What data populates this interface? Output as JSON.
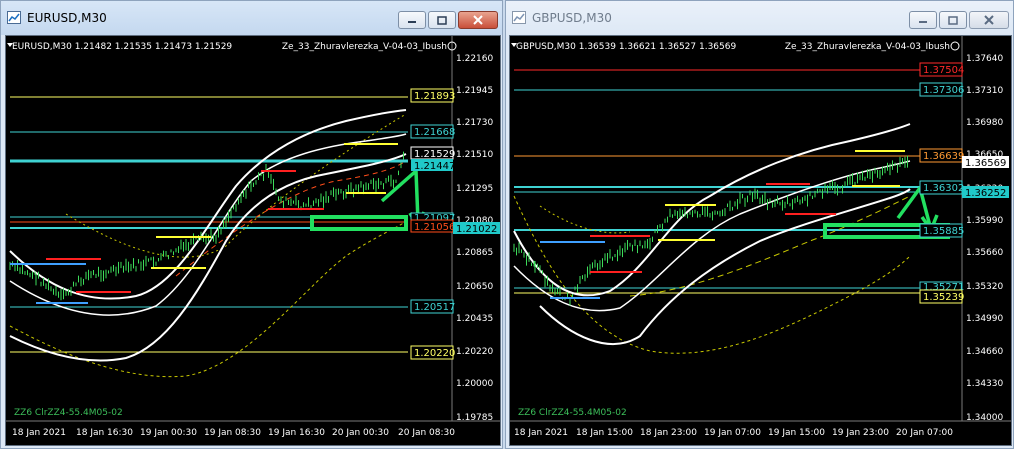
{
  "windows": [
    {
      "id": "eurusd",
      "title": "EURUSD,M30",
      "active": true,
      "symbol_info": "EURUSD,M30  1.21482 1.21535 1.21473 1.21529",
      "indicator": "Ze_33_Zhuravlerezka_V-04-03_Ibush",
      "footer": "ZZ6 ClrZZ4-55.4M05-02",
      "price_axis": [
        "1.22160",
        "1.21945",
        "1.21730",
        "1.21510",
        "1.21295",
        "1.21080",
        "1.20865",
        "1.20650",
        "1.20435",
        "1.20220",
        "1.20000",
        "1.19785"
      ],
      "time_axis": [
        "18 Jan 2021",
        "18 Jan 16:30",
        "19 Jan 00:30",
        "19 Jan 08:30",
        "19 Jan 16:30",
        "20 Jan 00:30",
        "20 Jan 08:30"
      ],
      "level_labels": [
        {
          "text": "1.21893",
          "color": "#ffff66"
        },
        {
          "text": "1.21668",
          "color": "#3fd3d3"
        },
        {
          "text": "1.21529",
          "color": "#ffffff"
        },
        {
          "text": "1.21447",
          "color": "#000000",
          "bg": "#20c9c9"
        },
        {
          "text": "1.21097",
          "color": "#3fd3d3"
        },
        {
          "text": "1.21056",
          "color": "#ff4d1a"
        },
        {
          "text": "1.21022",
          "color": "#000000",
          "bg": "#20c9c9"
        },
        {
          "text": "1.20517",
          "color": "#3fd3d3"
        },
        {
          "text": "1.20220",
          "color": "#ffff66"
        }
      ]
    },
    {
      "id": "gbpusd",
      "title": "GBPUSD,M30",
      "active": false,
      "symbol_info": "GBPUSD,M30  1.36539 1.36621 1.36527 1.36569",
      "indicator": "Ze_33_Zhuravlerezka_V-04-03_Ibush",
      "footer": "ZZ6 ClrZZ4-55.4M05-02",
      "price_axis": [
        "1.37640",
        "1.37310",
        "1.36980",
        "1.36650",
        "1.36320",
        "1.35990",
        "1.35660",
        "1.35320",
        "1.34990",
        "1.34660",
        "1.34330",
        "1.34000"
      ],
      "time_axis": [
        "18 Jan 2021",
        "18 Jan 15:00",
        "18 Jan 23:00",
        "19 Jan 07:00",
        "19 Jan 15:00",
        "19 Jan 23:00",
        "20 Jan 07:00"
      ],
      "level_labels": [
        {
          "text": "1.37504",
          "color": "#ff2a2a"
        },
        {
          "text": "1.37306",
          "color": "#3fd3d3"
        },
        {
          "text": "1.36639",
          "color": "#ff9a33"
        },
        {
          "text": "1.36569",
          "color": "#000000",
          "bg": "#ffffff"
        },
        {
          "text": "1.36302",
          "color": "#3fd3d3"
        },
        {
          "text": "1.36252",
          "color": "#000000",
          "bg": "#20c9c9"
        },
        {
          "text": "1.35885",
          "color": "#3fd3d3"
        },
        {
          "text": "1.35271",
          "color": "#3fd3d3"
        },
        {
          "text": "1.35239",
          "color": "#ffff66"
        }
      ]
    }
  ]
}
